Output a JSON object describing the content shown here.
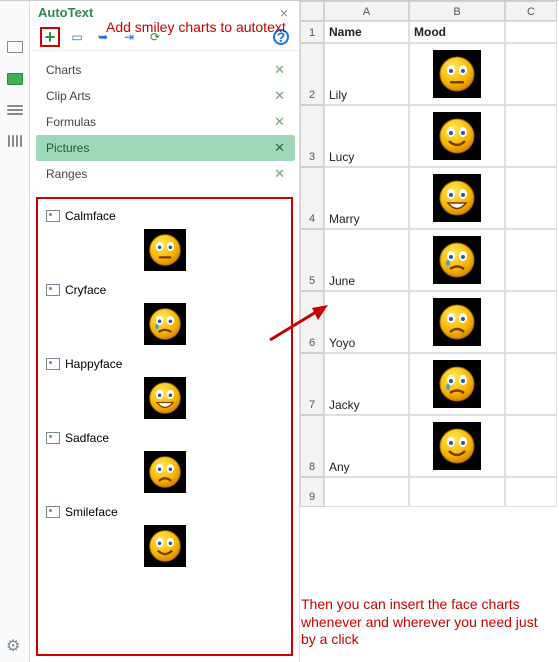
{
  "panel": {
    "title": "AutoText",
    "categories": [
      {
        "label": "Charts",
        "active": false
      },
      {
        "label": "Clip Arts",
        "active": false
      },
      {
        "label": "Formulas",
        "active": false
      },
      {
        "label": "Pictures",
        "active": true
      },
      {
        "label": "Ranges",
        "active": false
      }
    ],
    "items": [
      {
        "label": "Calmface",
        "face": "calm"
      },
      {
        "label": "Cryface",
        "face": "cry"
      },
      {
        "label": "Happyface",
        "face": "happy"
      },
      {
        "label": "Sadface",
        "face": "sad"
      },
      {
        "label": "Smileface",
        "face": "smile"
      }
    ]
  },
  "annotations": {
    "top": "Add smiley charts to autotext",
    "bottom": "Then you can insert the face charts whenever and wherever you need just by a click"
  },
  "sheet": {
    "columns": [
      "",
      "A",
      "B",
      "C"
    ],
    "headerRow": {
      "a": "Name",
      "b": "Mood"
    },
    "rows": [
      {
        "n": "2",
        "name": "Lily",
        "face": "calm"
      },
      {
        "n": "3",
        "name": "Lucy",
        "face": "smile"
      },
      {
        "n": "4",
        "name": "Marry",
        "face": "happy"
      },
      {
        "n": "5",
        "name": "June",
        "face": "cry"
      },
      {
        "n": "6",
        "name": "Yoyo",
        "face": "sad"
      },
      {
        "n": "7",
        "name": "Jacky",
        "face": "cry"
      },
      {
        "n": "8",
        "name": "Any",
        "face": "smile"
      }
    ],
    "extraRow": "9"
  }
}
